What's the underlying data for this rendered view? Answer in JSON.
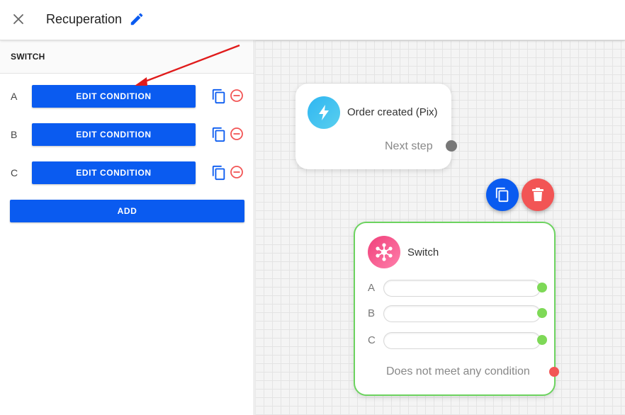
{
  "header": {
    "title": "Recuperation",
    "close_icon": "close-icon",
    "edit_icon": "pencil-icon"
  },
  "panel": {
    "title": "SWITCH",
    "conditions": [
      {
        "letter": "A",
        "button_label": "EDIT CONDITION"
      },
      {
        "letter": "B",
        "button_label": "EDIT CONDITION"
      },
      {
        "letter": "C",
        "button_label": "EDIT CONDITION"
      }
    ],
    "copy_icon": "copy-icon",
    "remove_icon": "remove-circle-icon",
    "add_label": "ADD"
  },
  "canvas": {
    "trigger_node": {
      "label": "Order created (Pix)",
      "icon": "lightning-icon",
      "next_label": "Next step"
    },
    "actions": {
      "copy_icon": "copy-icon",
      "delete_icon": "trash-icon"
    },
    "switch_node": {
      "label": "Switch",
      "icon": "network-hub-icon",
      "conditions": [
        "A",
        "B",
        "C"
      ],
      "no_match_label": "Does not meet any condition"
    }
  },
  "colors": {
    "primary": "#0a5bf0",
    "danger": "#f25555",
    "success": "#7ed957",
    "node_border": "#6cd35f",
    "annotation_arrow": "#e01b1b"
  }
}
